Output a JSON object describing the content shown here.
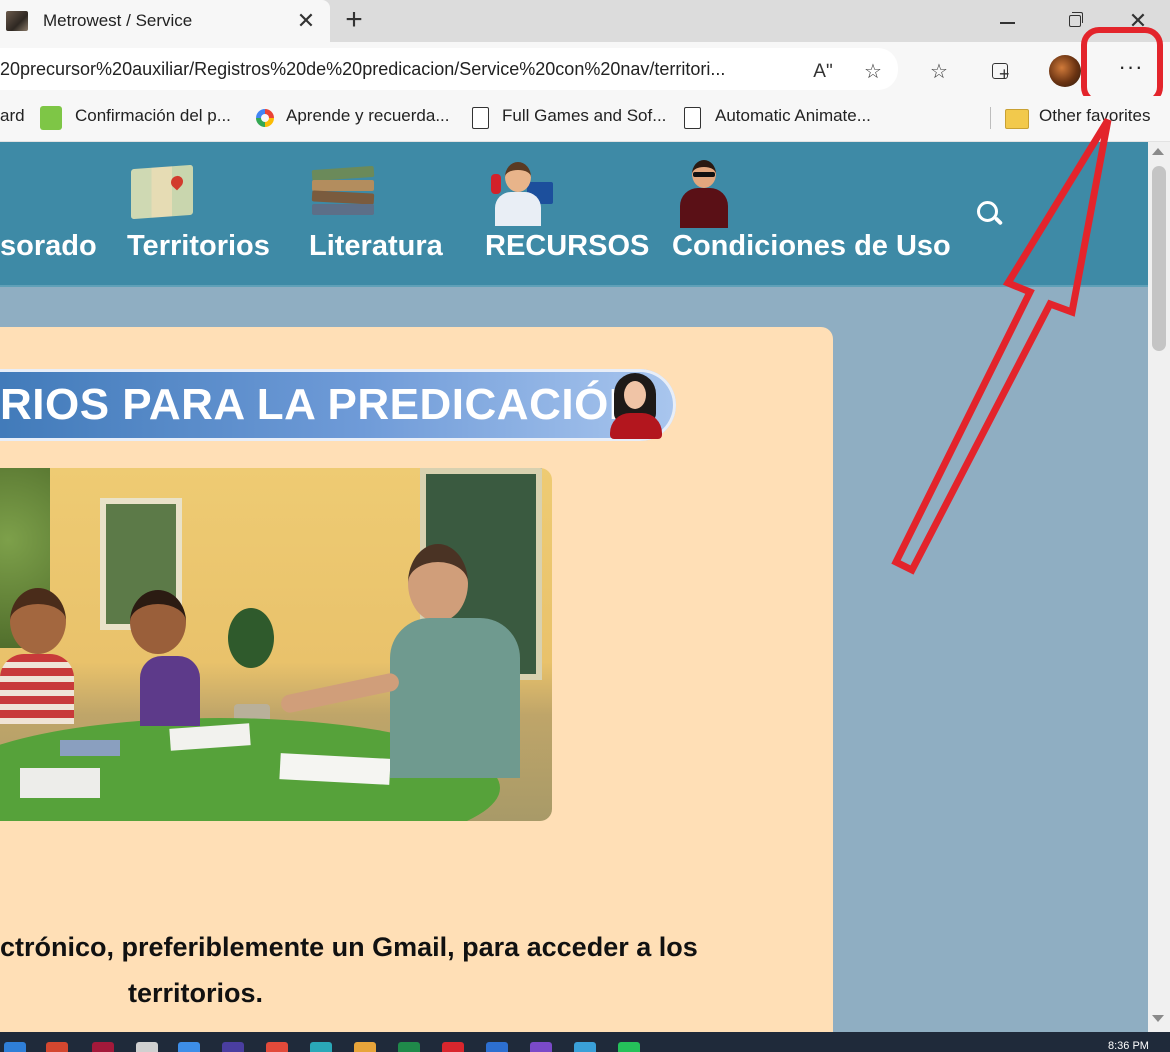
{
  "browser": {
    "tab_title": "Metrowest / Service",
    "tab_close": "✕",
    "new_tab": "+",
    "window_close": "✕",
    "url": "20precursor%20auxiliar/Registros%20de%20predicacion/Service%20con%20nav/territori...",
    "read_aloud": "Aʺ",
    "favorite_add": "☆",
    "favorites": "☆",
    "more": "···",
    "bookmarks": [
      {
        "label": "ard"
      },
      {
        "label": "Confirmación del p..."
      },
      {
        "label": "Aprende y recuerda..."
      },
      {
        "label": "Full Games and Sof..."
      },
      {
        "label": "Automatic Animate..."
      },
      {
        "label": "Other favorites"
      }
    ]
  },
  "nav": {
    "items": [
      {
        "label": "sorado"
      },
      {
        "label": "Territorios"
      },
      {
        "label": "Literatura"
      },
      {
        "label": "RECURSOS"
      },
      {
        "label": "Condiciones de Uso"
      }
    ]
  },
  "content": {
    "banner": "RIOS PARA LA PREDICACIÓN",
    "message_line1": "ctrónico, preferiblemente un Gmail, para acceder a los",
    "message_line2": "territorios."
  },
  "annotation": {
    "color": "#e3242b"
  },
  "taskbar": {
    "clock": "8:36 PM"
  },
  "colors": {
    "nav_bg": "#3e8aa6",
    "page_bg": "#8faec2",
    "card_bg": "#ffdfb6"
  }
}
